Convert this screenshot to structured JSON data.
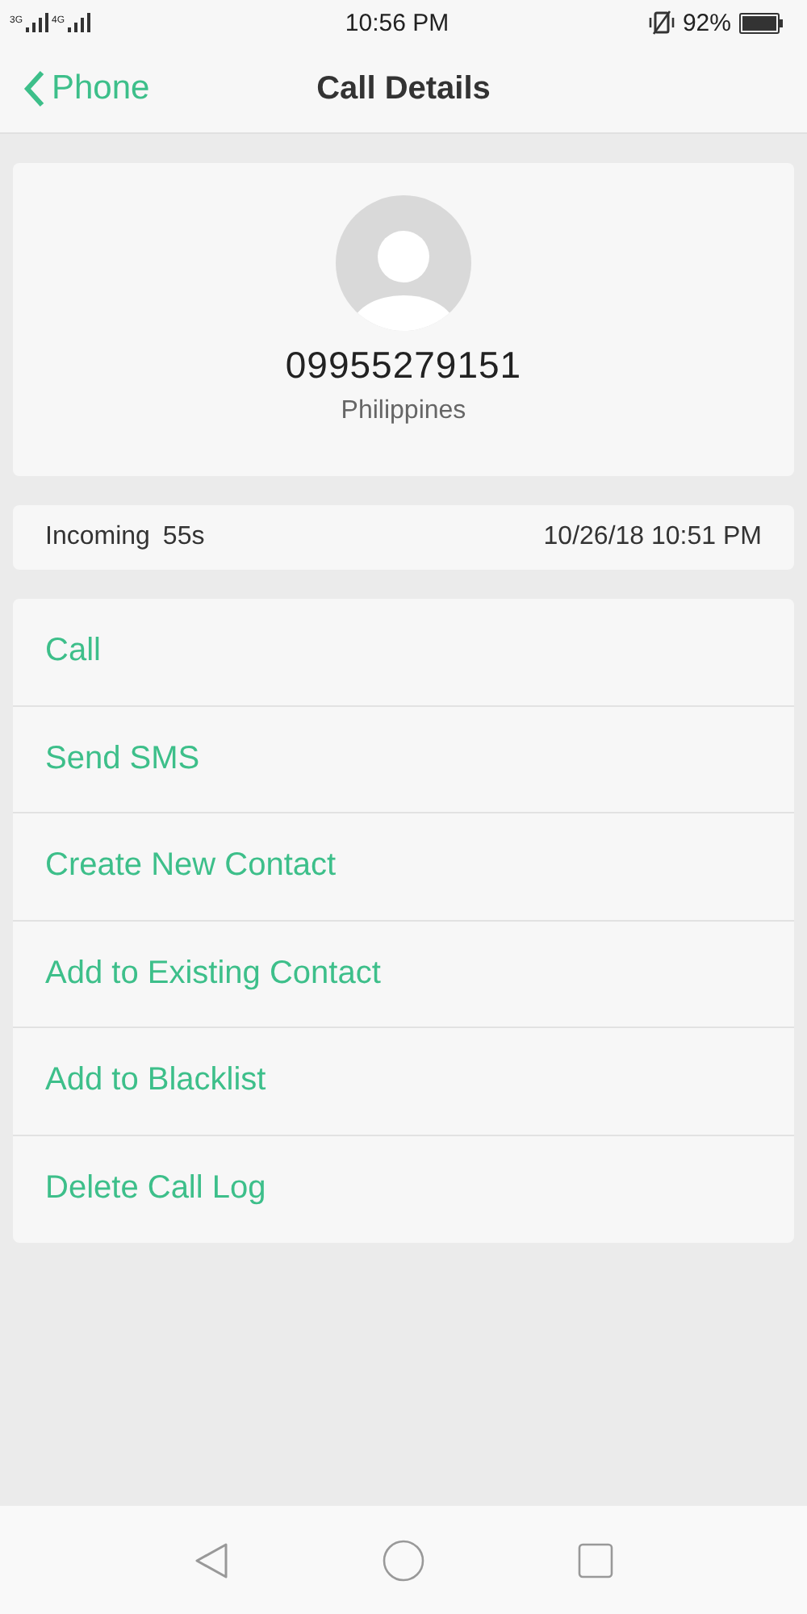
{
  "status_bar": {
    "network_1": "3G",
    "network_2": "4G",
    "time": "10:56 PM",
    "battery": "92%"
  },
  "header": {
    "back_label": "Phone",
    "title": "Call Details"
  },
  "contact": {
    "number": "09955279151",
    "location": "Philippines"
  },
  "call": {
    "type": "Incoming",
    "duration": "55s",
    "datetime": "10/26/18 10:51 PM"
  },
  "actions": [
    "Call",
    "Send SMS",
    "Create New Contact",
    "Add to Existing Contact",
    "Add to Blacklist",
    "Delete Call Log"
  ]
}
